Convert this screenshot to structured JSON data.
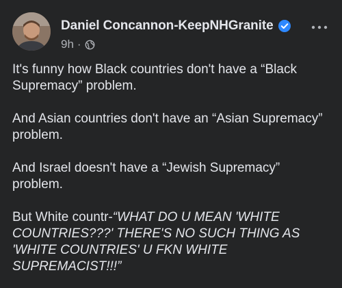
{
  "post": {
    "author": "Daniel Concannon-KeepNHGranite",
    "timestamp": "9h",
    "separator": "·",
    "icons": {
      "verified": "verified-badge-icon",
      "audience": "globe-icon",
      "more": "more-options-icon"
    },
    "colors": {
      "background": "#242526",
      "verified": "#2d88ff",
      "text": "#e4e6eb",
      "meta": "#b0b3b8"
    },
    "paragraphs": [
      "It's funny how Black countries don't have a “Black Supremacy” problem.",
      "And Asian countries don't have an “Asian Supremacy” problem.",
      "And Israel doesn't have a “Jewish Supremacy” problem."
    ],
    "last_paragraph_plain": "But White countr-",
    "last_paragraph_italic": "“WHAT DO U MEAN 'WHITE COUNTRIES???' THERE'S NO SUCH THING AS 'WHITE COUNTRIES' U FKN WHITE SUPREMACIST!!!”"
  }
}
